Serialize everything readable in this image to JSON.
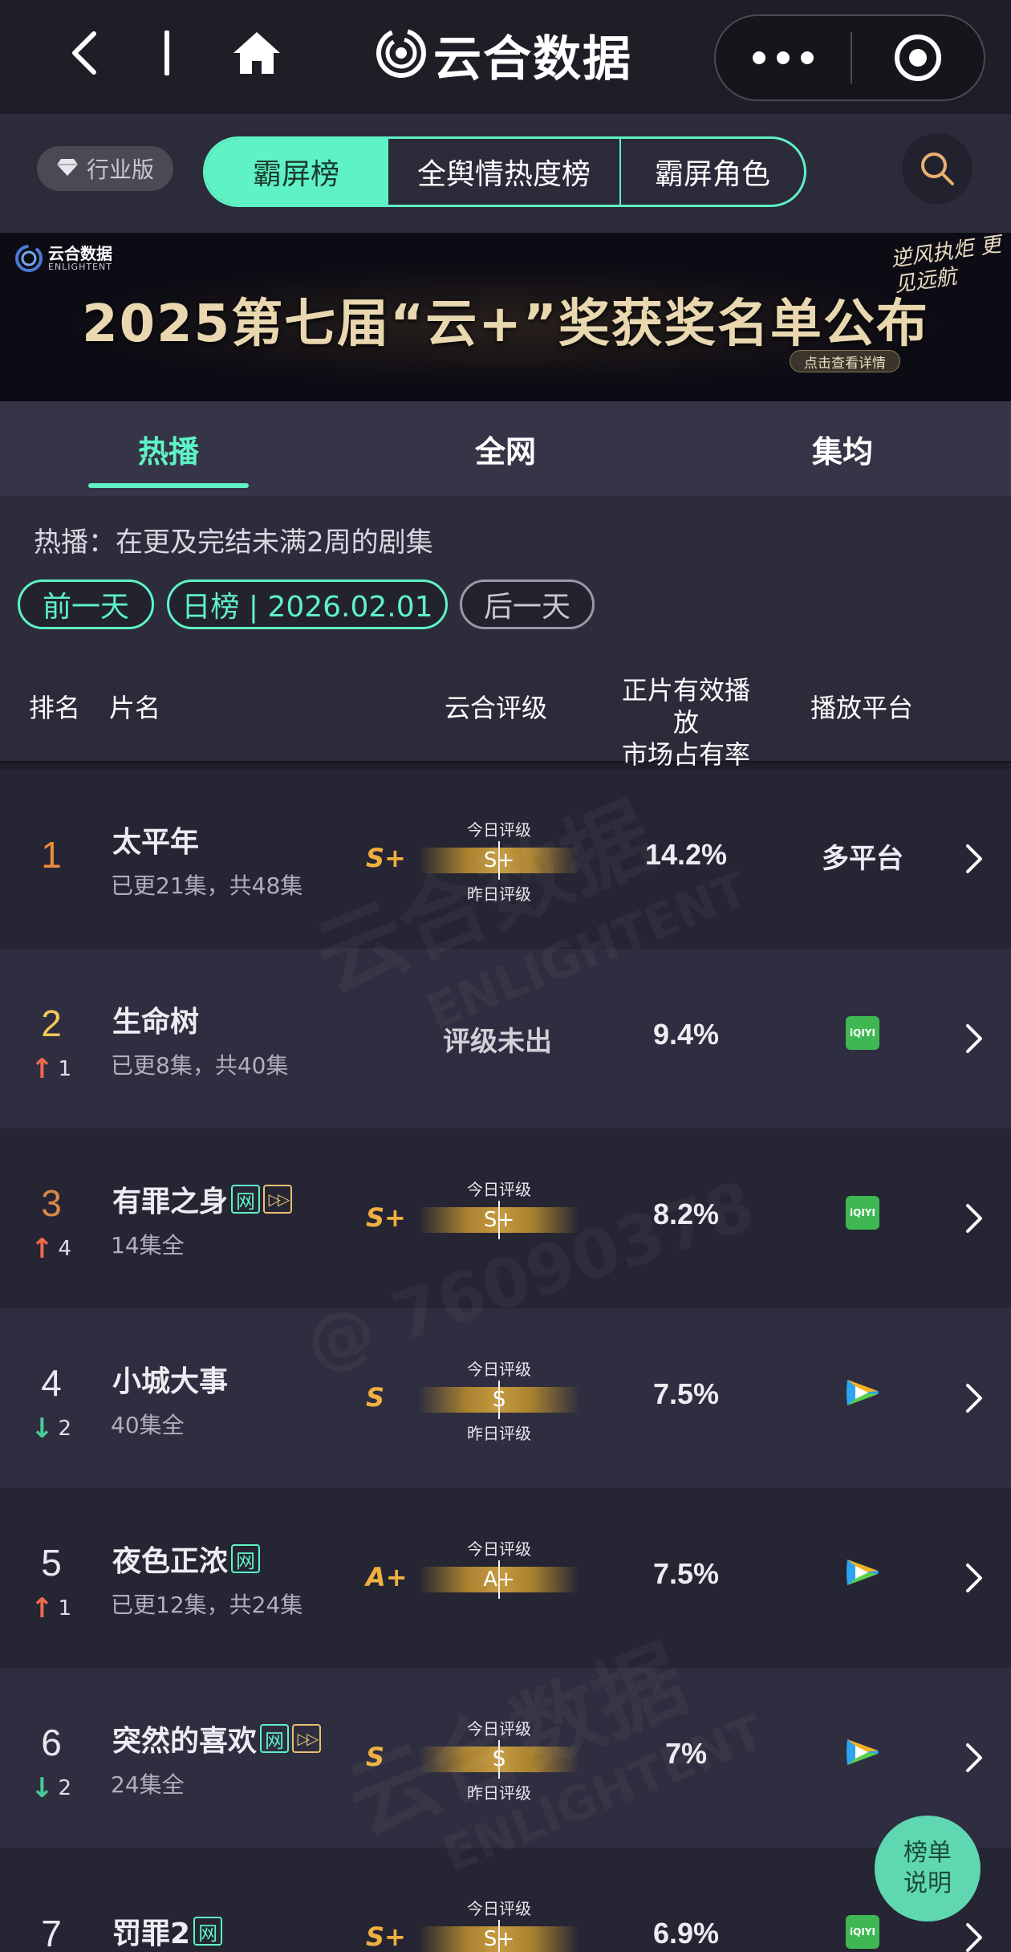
{
  "nav": {
    "title": "云合数据"
  },
  "segment": {
    "edition": "行业版",
    "tabs": [
      "霸屏榜",
      "全舆情热度榜",
      "霸屏角色"
    ],
    "active": 0
  },
  "banner": {
    "logo_cn": "云合数据",
    "logo_en": "ENLIGHTENT",
    "title": "2025第七届“云+”奖获奖名单公布",
    "button": "点击查看详情",
    "slogan": "逆风执炬 更见远航"
  },
  "tabs": [
    "热播",
    "全网",
    "集均"
  ],
  "filter": {
    "description": "热播：在更及完结未满2周的剧集",
    "prev": "前一天",
    "current": "日榜 | 2026.02.01",
    "next": "后一天"
  },
  "table_header": {
    "rank": "排名",
    "title": "片名",
    "grade": "云合评级",
    "share_line1": "正片有效播放",
    "share_line2": "市场占有率",
    "platform": "播放平台"
  },
  "grade_labels": {
    "today": "今日评级",
    "yesterday": "昨日评级",
    "none": "评级未出"
  },
  "rows": [
    {
      "rank": "1",
      "change_dir": "",
      "change": "",
      "title": "太平年",
      "tags": [],
      "episodes": "已更21集，共48集",
      "grade": "S+",
      "grade_today": "S+",
      "has_yesterday": true,
      "no_grade": false,
      "share": "14.2%",
      "platform": "多平台",
      "platform_icon": "text"
    },
    {
      "rank": "2",
      "change_dir": "up",
      "change": "1",
      "title": "生命树",
      "tags": [],
      "episodes": "已更8集，共40集",
      "grade": "",
      "grade_today": "",
      "has_yesterday": false,
      "no_grade": true,
      "share": "9.4%",
      "platform": "",
      "platform_icon": "iqiyi"
    },
    {
      "rank": "3",
      "change_dir": "up",
      "change": "4",
      "title": "有罪之身",
      "tags": [
        "网",
        "vip"
      ],
      "episodes": "14集全",
      "grade": "S+",
      "grade_today": "S+",
      "has_yesterday": false,
      "no_grade": false,
      "share": "8.2%",
      "platform": "",
      "platform_icon": "iqiyi"
    },
    {
      "rank": "4",
      "change_dir": "down",
      "change": "2",
      "title": "小城大事",
      "tags": [],
      "episodes": "40集全",
      "grade": "S",
      "grade_today": "S",
      "has_yesterday": true,
      "no_grade": false,
      "share": "7.5%",
      "platform": "",
      "platform_icon": "tencent"
    },
    {
      "rank": "5",
      "change_dir": "up",
      "change": "1",
      "title": "夜色正浓",
      "tags": [
        "网"
      ],
      "episodes": "已更12集，共24集",
      "grade": "A+",
      "grade_today": "A+",
      "has_yesterday": false,
      "no_grade": false,
      "share": "7.5%",
      "platform": "",
      "platform_icon": "tencent"
    },
    {
      "rank": "6",
      "change_dir": "down",
      "change": "2",
      "title": "突然的喜欢",
      "tags": [
        "网",
        "vip"
      ],
      "episodes": "24集全",
      "grade": "S",
      "grade_today": "S",
      "has_yesterday": true,
      "no_grade": false,
      "share": "7%",
      "platform": "",
      "platform_icon": "tencent"
    },
    {
      "rank": "7",
      "change_dir": "",
      "change": "",
      "title": "罚罪2",
      "tags": [
        "网"
      ],
      "episodes": "",
      "grade": "S+",
      "grade_today": "S+",
      "has_yesterday": false,
      "no_grade": false,
      "share": "6.9%",
      "platform": "",
      "platform_icon": "iqiyi"
    }
  ],
  "platform_labels": {
    "iqiyi": "iQIYI"
  },
  "help": {
    "line1": "榜单",
    "line2": "说明"
  },
  "watermark": {
    "brand": "云合数据",
    "brand_en": "ENLIGHTENT",
    "id": "@ 76090378"
  },
  "colors": {
    "accent": "#5ff2c4",
    "gold": "#f0b040",
    "up": "#ee6a4a",
    "down": "#4cc89a"
  }
}
